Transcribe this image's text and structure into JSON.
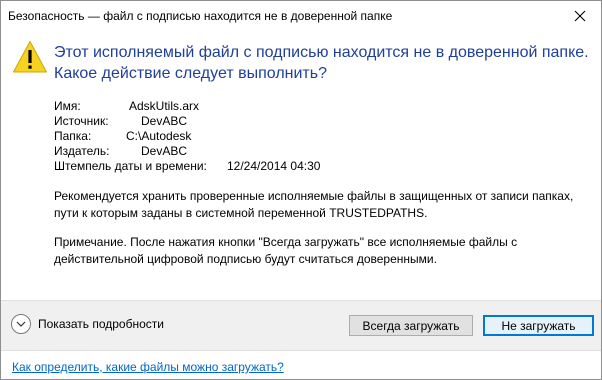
{
  "window": {
    "title": "Безопасность — файл с подписью находится не в доверенной папке"
  },
  "heading": "Этот исполняемый файл с подписью находится не в доверенной папке. Какое действие следует выполнить?",
  "info": {
    "name_label": "Имя:",
    "name_value": "AdskUtils.arx",
    "source_label": "Источник:",
    "source_value": "DevABC",
    "folder_label": "Папка:",
    "folder_value": "C:\\Autodesk",
    "publisher_label": "Издатель:",
    "publisher_value": "DevABC",
    "timestamp_label": "Штемпель даты и времени:",
    "timestamp_value": "12/24/2014 04:30"
  },
  "recommendation": "Рекомендуется хранить проверенные исполняемые файлы в защищенных от записи папках, пути к которым заданы в системной переменной TRUSTEDPATHS.",
  "note": "Примечание. После нажатия кнопки \"Всегда загружать\" все исполняемые файлы с действительной цифровой подписью будут считаться доверенными.",
  "footer": {
    "details_label": "Показать подробности",
    "always_load": "Всегда загружать",
    "do_not_load": "Не загружать"
  },
  "help_link": "Как определить, какие файлы можно загружать?",
  "colors": {
    "heading": "#1f3f99",
    "warning_fill": "#f7d21e",
    "link": "#0066cc",
    "default_button_border": "#0078d7"
  },
  "icons": {
    "warning": "warning-icon",
    "close": "close-icon",
    "details": "chevron-down-icon"
  }
}
